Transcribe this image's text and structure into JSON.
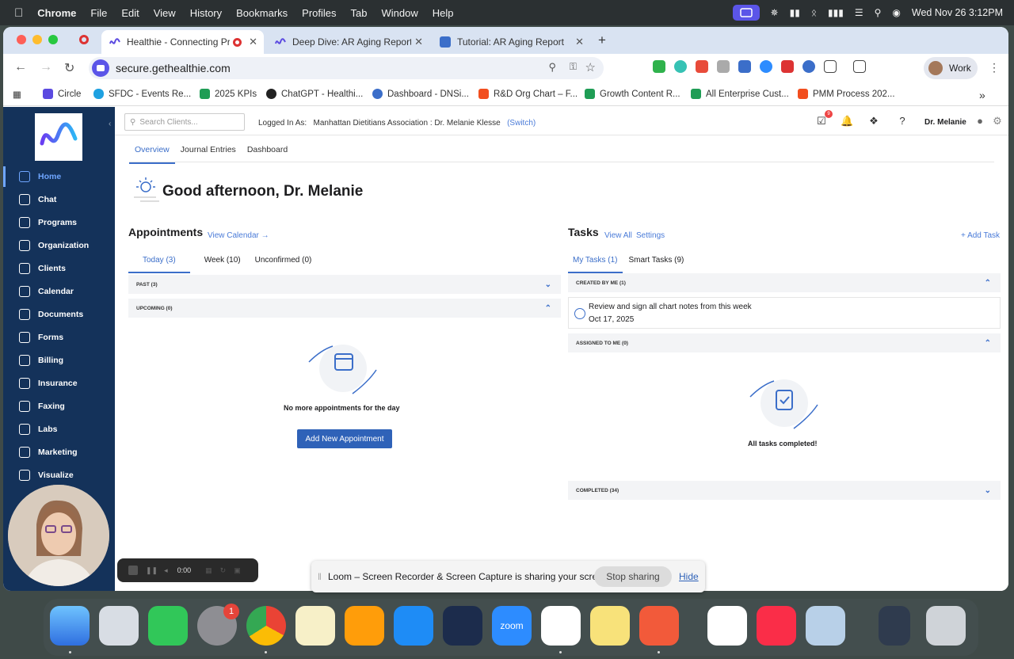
{
  "menubar": {
    "app": "Chrome",
    "items": [
      "File",
      "Edit",
      "View",
      "History",
      "Bookmarks",
      "Profiles",
      "Tab",
      "Window",
      "Help"
    ],
    "clock": "Wed Nov 26  3:12PM"
  },
  "tabs": [
    {
      "title": "Healthie - Connecting Pro",
      "active": true
    },
    {
      "title": "Deep Dive: AR Aging Report",
      "active": false
    },
    {
      "title": "Tutorial: AR Aging Report",
      "active": false
    }
  ],
  "new_tab": "+",
  "url": "secure.gethealthie.com",
  "profile": "Work",
  "bookmarks": [
    "Circle",
    "SFDC - Events Re...",
    "2025 KPIs",
    "ChatGPT - Healthi...",
    "Dashboard - DNSi...",
    "R&D Org Chart – F...",
    "Growth Content R...",
    "All Enterprise Cust...",
    "PMM Process 202..."
  ],
  "sidebar": {
    "items": [
      "Home",
      "Chat",
      "Programs",
      "Organization",
      "Clients",
      "Calendar",
      "Documents",
      "Forms",
      "Billing",
      "Insurance",
      "Faxing",
      "Labs",
      "Marketing",
      "Visualize"
    ],
    "active": "Home"
  },
  "header": {
    "search_placeholder": "Search Clients...",
    "logged_in_label": "Logged In As:",
    "logged_in_value": "Manhattan Dietitians Association : Dr. Melanie Klesse",
    "switch": "(Switch)",
    "user": "Dr. Melanie",
    "notification_count": "9"
  },
  "subtabs": [
    "Overview",
    "Journal Entries",
    "Dashboard"
  ],
  "greeting": "Good afternoon, Dr. Melanie",
  "appointments": {
    "title": "Appointments",
    "link": "View Calendar →",
    "tabs": [
      "Today (3)",
      "Week (10)",
      "Unconfirmed (0)"
    ],
    "past": "PAST (3)",
    "upcoming": "UPCOMING (0)",
    "empty": "No more appointments for the day",
    "button": "Add New Appointment"
  },
  "tasks": {
    "title": "Tasks",
    "view_all": "View All",
    "settings": "Settings",
    "add": "+ Add Task",
    "tabs": [
      "My Tasks (1)",
      "Smart Tasks (9)"
    ],
    "created_by_me": "CREATED BY ME (1)",
    "task_title": "Review and sign all chart notes from this week",
    "task_date": "Oct 17, 2025",
    "assigned_to_me": "ASSIGNED TO ME (0)",
    "empty": "All tasks completed!",
    "completed": "COMPLETED (34)"
  },
  "loom": {
    "timer": "0:00",
    "share_text": "Loom – Screen Recorder & Screen Capture is sharing your screen.",
    "stop": "Stop sharing",
    "hide": "Hide"
  },
  "dock": {
    "settings_badge": "1",
    "zoom_label": "zoom"
  },
  "colors": {
    "sidebar": "#14325a",
    "accent": "#3b6ec9",
    "button": "#2f62b8"
  }
}
